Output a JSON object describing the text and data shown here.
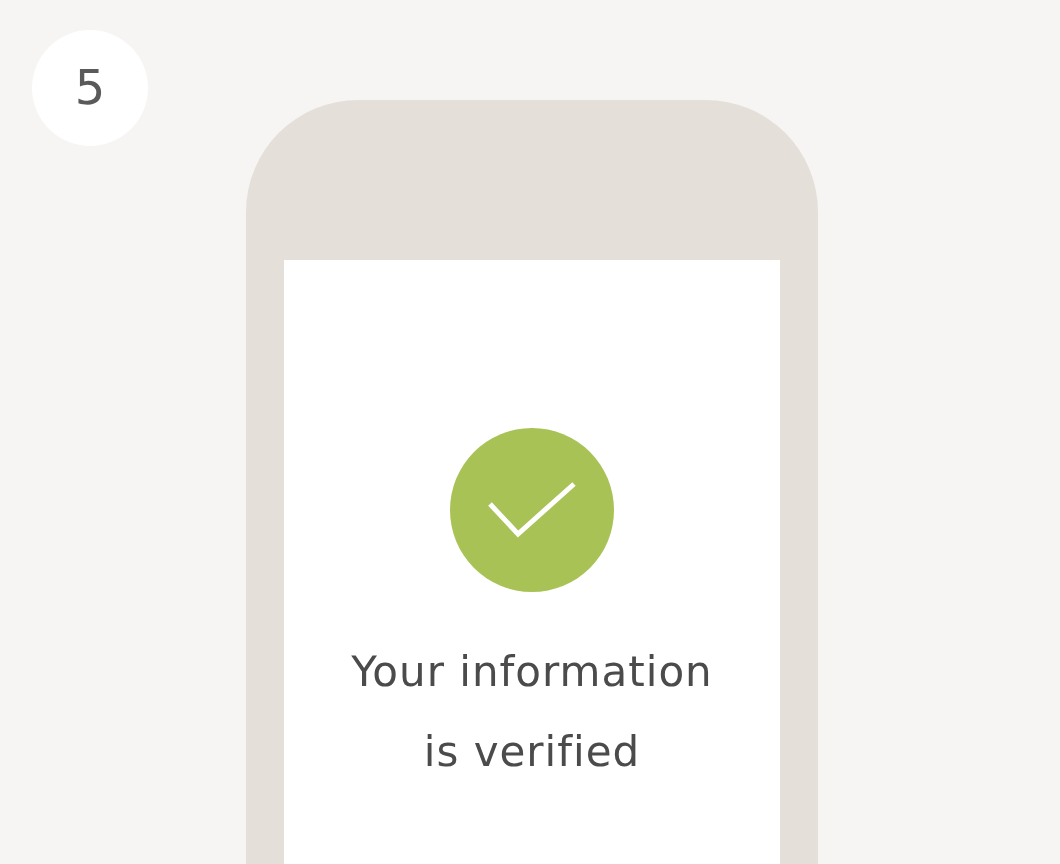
{
  "step_badge": "5",
  "status": {
    "kind": "verified"
  },
  "message_lines": [
    "Your information",
    "is verified"
  ]
}
